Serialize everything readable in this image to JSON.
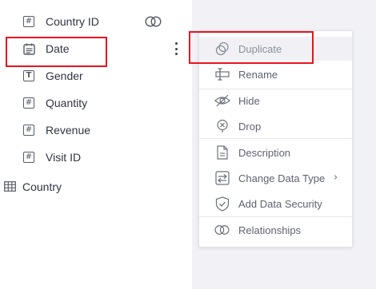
{
  "fields": [
    {
      "label": "Country ID",
      "icon": "hash-icon"
    },
    {
      "label": "Date",
      "icon": "calendar-icon"
    },
    {
      "label": "Gender",
      "icon": "text-icon"
    },
    {
      "label": "Quantity",
      "icon": "hash-icon"
    },
    {
      "label": "Revenue",
      "icon": "hash-icon"
    },
    {
      "label": "Visit ID",
      "icon": "hash-icon"
    }
  ],
  "table": {
    "label": "Country",
    "icon": "table-icon"
  },
  "context_menu": {
    "duplicate": "Duplicate",
    "rename": "Rename",
    "hide": "Hide",
    "drop": "Drop",
    "description": "Description",
    "change_data_type": "Change Data Type",
    "add_data_security": "Add Data Security",
    "relationships": "Relationships"
  },
  "colors": {
    "highlight": "#e8131f",
    "panel_bg": "#f1f1f6"
  }
}
